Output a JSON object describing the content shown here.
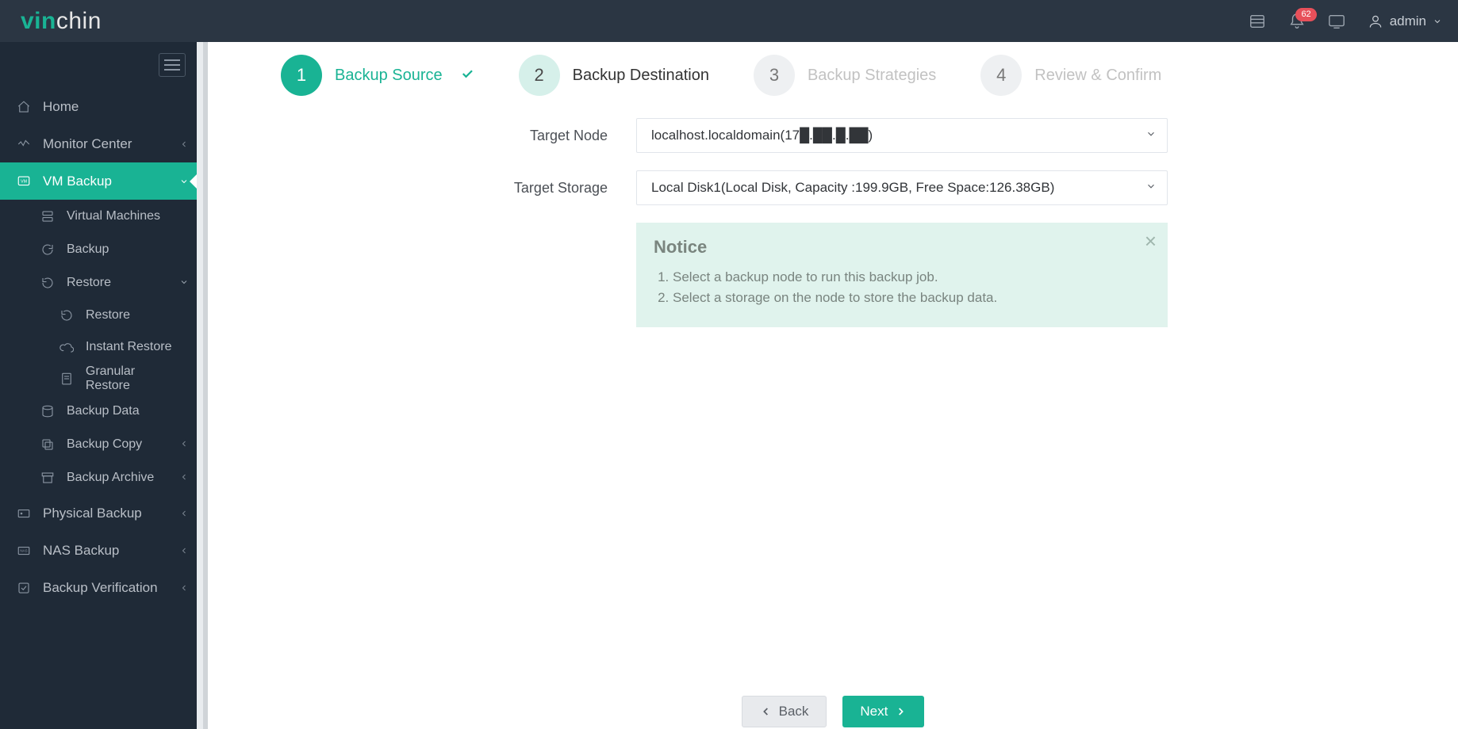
{
  "brand": {
    "v": "vin",
    "rest": "chin"
  },
  "topbar": {
    "badge_count": "62",
    "user_label": "admin"
  },
  "sidebar": {
    "home": "Home",
    "monitor": "Monitor Center",
    "vm_backup": "VM Backup",
    "vm_sub": {
      "virtual_machines": "Virtual Machines",
      "backup": "Backup",
      "restore": "Restore",
      "restore_sub": {
        "restore": "Restore",
        "instant": "Instant Restore",
        "granular": "Granular Restore"
      },
      "backup_data": "Backup Data",
      "backup_copy": "Backup Copy",
      "backup_archive": "Backup Archive"
    },
    "physical_backup": "Physical Backup",
    "nas_backup": "NAS Backup",
    "backup_verification": "Backup Verification"
  },
  "steps": {
    "s1": {
      "num": "1",
      "label": "Backup Source"
    },
    "s2": {
      "num": "2",
      "label": "Backup Destination"
    },
    "s3": {
      "num": "3",
      "label": "Backup Strategies"
    },
    "s4": {
      "num": "4",
      "label": "Review & Confirm"
    }
  },
  "form": {
    "target_node_label": "Target Node",
    "target_node_value": "localhost.localdomain(17█.██.█.██)",
    "target_storage_label": "Target Storage",
    "target_storage_value": "Local Disk1(Local Disk, Capacity :199.9GB, Free Space:126.38GB)"
  },
  "notice": {
    "title": "Notice",
    "item1": "Select a backup node to run this backup job.",
    "item2": "Select a storage on the node to store the backup data."
  },
  "buttons": {
    "back": "Back",
    "next": "Next"
  }
}
